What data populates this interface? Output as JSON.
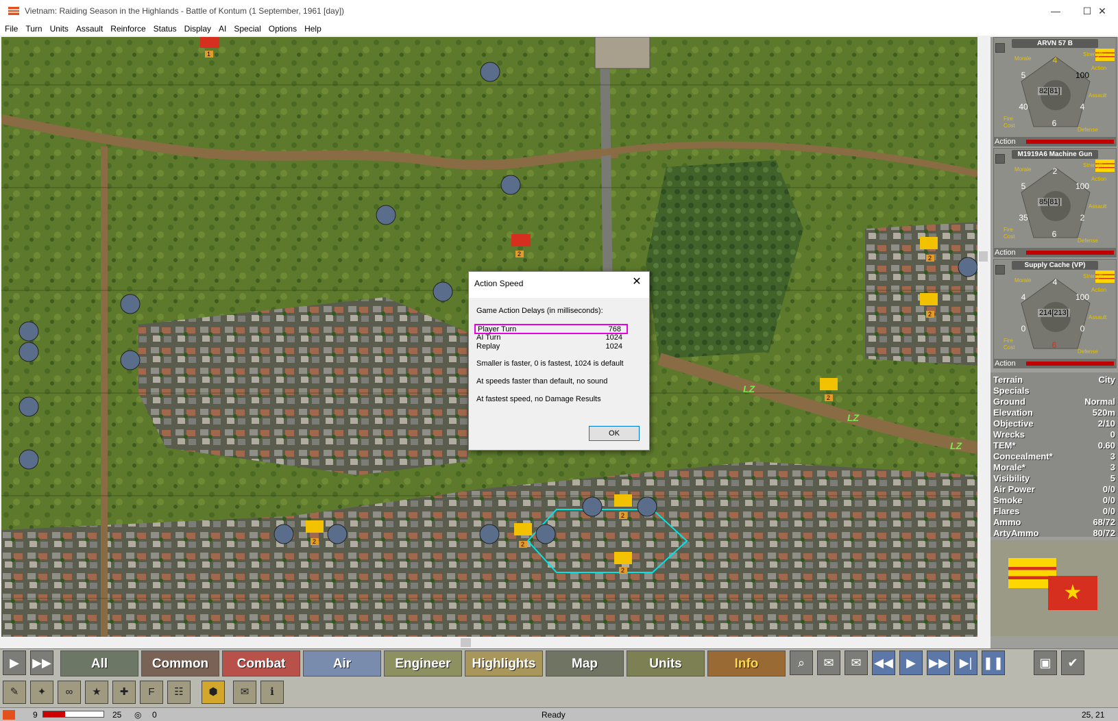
{
  "window": {
    "title": "Vietnam: Raiding Season in the Highlands - Battle of Kontum (1 September, 1961 [day])",
    "minimize": "—",
    "maximize": "☐",
    "close": "✕"
  },
  "menu": [
    "File",
    "Turn",
    "Units",
    "Assault",
    "Reinforce",
    "Status",
    "Display",
    "AI",
    "Special",
    "Options",
    "Help"
  ],
  "map": {
    "lz_markers": [
      "LZ",
      "LZ",
      "LZ"
    ],
    "unit_counts": [
      "1",
      "2",
      "2",
      "2",
      "2",
      "2",
      "2",
      "2",
      "2"
    ]
  },
  "dialog": {
    "title": "Action Speed",
    "close": "✕",
    "heading": "Game Action Delays (in milliseconds):",
    "rows": [
      {
        "label": "Player Turn",
        "value": "768"
      },
      {
        "label": "AI Turn",
        "value": "1024"
      },
      {
        "label": "Replay",
        "value": "1024"
      }
    ],
    "note1": "Smaller is faster, 0 is fastest, 1024 is default",
    "note2": "At speeds faster than default, no sound",
    "note3": "At fastest speed, no Damage Results",
    "ok": "OK"
  },
  "units": [
    {
      "name": "ARVN 57 B",
      "strength": "4",
      "morale": "5",
      "action": "100",
      "assault": "4",
      "defense": "6",
      "fire": "40",
      "center": "82[81]"
    },
    {
      "name": "M1919A6 Machine Gun",
      "strength": "2",
      "morale": "5",
      "action": "100",
      "assault": "2",
      "defense": "6",
      "fire": "35",
      "center": "85[81]"
    },
    {
      "name": "Supply Cache (VP)",
      "strength": "4",
      "morale": "4",
      "action": "100",
      "assault": "0",
      "defense": "6",
      "fire": "0",
      "center": "214[213]"
    }
  ],
  "unit_labels": {
    "strength": "Strength",
    "morale": "Morale",
    "action": "Action",
    "assault": "Assault",
    "fire": "Fire",
    "cost": "Cost",
    "defense": "Defense",
    "action_bar": "Action"
  },
  "terrain": [
    {
      "k": "Terrain",
      "v": "City"
    },
    {
      "k": "Specials",
      "v": ""
    },
    {
      "k": "Ground",
      "v": "Normal"
    },
    {
      "k": "Elevation",
      "v": "520m"
    },
    {
      "k": "Objective",
      "v": "2/10"
    },
    {
      "k": "Wrecks",
      "v": "0"
    },
    {
      "k": "TEM*",
      "v": "0.60"
    },
    {
      "k": "Concealment*",
      "v": "3"
    },
    {
      "k": "Morale*",
      "v": "3"
    },
    {
      "k": "Visibility",
      "v": "5"
    },
    {
      "k": "Air Power",
      "v": "0/0"
    },
    {
      "k": "Smoke",
      "v": "0/0"
    },
    {
      "k": "Flares",
      "v": "0/0"
    },
    {
      "k": "Ammo",
      "v": "68/72"
    },
    {
      "k": "ArtyAmmo",
      "v": "80/72"
    }
  ],
  "toolbar": {
    "tabs": [
      "All",
      "Common",
      "Combat",
      "Air",
      "Engineer",
      "Highlights",
      "Map",
      "Units",
      "Info"
    ]
  },
  "status": {
    "left1": "9",
    "left2": "25",
    "left3": "0",
    "center": "Ready",
    "coords": "25, 21"
  },
  "colors": {
    "tab_all": "#6d7766",
    "tab_common": "#7a6254",
    "tab_combat": "#b9514b",
    "tab_air": "#7a8cae",
    "tab_engineer": "#8d9162",
    "tab_highlights": "#a8965a",
    "tab_map": "#6f7562",
    "tab_units": "#7c8052",
    "tab_info": "#9a6a34"
  }
}
